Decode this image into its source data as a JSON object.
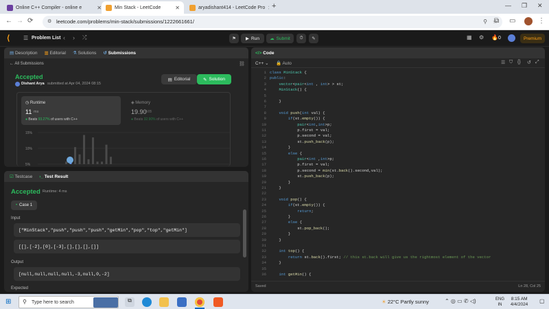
{
  "browser": {
    "tabs": [
      {
        "title": "Online C++ Compiler - online e",
        "icon_color": "#6b3fa0"
      },
      {
        "title": "Min Stack - LeetCode",
        "icon_color": "#f0a030"
      },
      {
        "title": "aryadishant414 - LeetCode Pro",
        "icon_color": "#f0a030"
      }
    ],
    "url": "leetcode.com/problems/min-stack/submissions/1222661661/"
  },
  "nav": {
    "problem_list": "Problem List",
    "run": "Run",
    "submit": "Submit",
    "streak": "0",
    "premium": "Premium"
  },
  "left_tabs": [
    "Description",
    "Editorial",
    "Solutions",
    "Submissions"
  ],
  "submission": {
    "all_link": "All Submissions",
    "status": "Accepted",
    "user": "Dishant Arya",
    "submitted_text": "submitted at Apr 04, 2024 08:15",
    "editorial_btn": "Editorial",
    "solution_btn": "Solution",
    "runtime_label": "Runtime",
    "runtime_value": "11",
    "runtime_unit": "ms",
    "runtime_beats_prefix": "Beats",
    "runtime_beats": "93.27%",
    "runtime_beats_suffix": "of users with C++",
    "memory_label": "Memory",
    "memory_value": "19.90",
    "memory_unit": "MB",
    "memory_beats_prefix": "Beats",
    "memory_beats": "32.90%",
    "memory_beats_suffix": "of users with C++",
    "chart_ticks": [
      "15%",
      "10%",
      "5%"
    ]
  },
  "chart_data": {
    "type": "bar",
    "title": "",
    "yticks": [
      "15%",
      "10%",
      "5%"
    ],
    "ylim": [
      4,
      17
    ],
    "values": [
      1,
      2,
      7,
      4,
      12,
      2,
      11,
      1,
      1,
      8,
      3
    ],
    "bar_colors": {
      "default": "#4a4a4a",
      "highlight": "#5b8ef0"
    }
  },
  "testpanel": {
    "tabs": [
      "Testcase",
      "Test Result"
    ],
    "status": "Accepted",
    "runtime_text": "Runtime: 4 ms",
    "case_label": "Case 1",
    "input_label": "Input",
    "input_line1": "[\"MinStack\",\"push\",\"push\",\"push\",\"getMin\",\"pop\",\"top\",\"getMin\"]",
    "input_line2": "[[],[-2],[0],[-3],[],[],[],[]]",
    "output_label": "Output",
    "output_value": "[null,null,null,null,-3,null,0,-2]",
    "expected_label": "Expected"
  },
  "editor": {
    "title": "Code",
    "language": "C++",
    "mode": "Auto",
    "status_left": "Saved",
    "status_right": "Ln 28, Col 25",
    "lines": [
      "class MinStack {",
      "public:",
      "    vector<pair<int , int> > st;",
      "    MinStack() {",
      "",
      "    }",
      "",
      "    void push(int val) {",
      "        if(st.empty()) {",
      "            pair<int,int>p;",
      "            p.first = val;",
      "            p.second = val;",
      "            st.push_back(p);",
      "        }",
      "        else {",
      "            pair<int ,int>p;",
      "            p.first = val;",
      "            p.second = min(st.back().second,val);",
      "            st.push_back(p);",
      "        }",
      "    }",
      "",
      "    void pop() {",
      "        if(st.empty()) {",
      "            return;",
      "        }",
      "        else {",
      "            st.pop_back();",
      "        }",
      "    }",
      "",
      "    int top() {",
      "        return st.back().first; // this st.back will give us the rightmost element of the vector",
      "    }",
      "",
      "    int getMin() {"
    ]
  },
  "taskbar": {
    "search_placeholder": "Type here to search",
    "weather": "22°C  Partly sunny",
    "lang1": "ENG",
    "lang2": "IN",
    "time": "8:15 AM",
    "date": "4/4/2024"
  }
}
